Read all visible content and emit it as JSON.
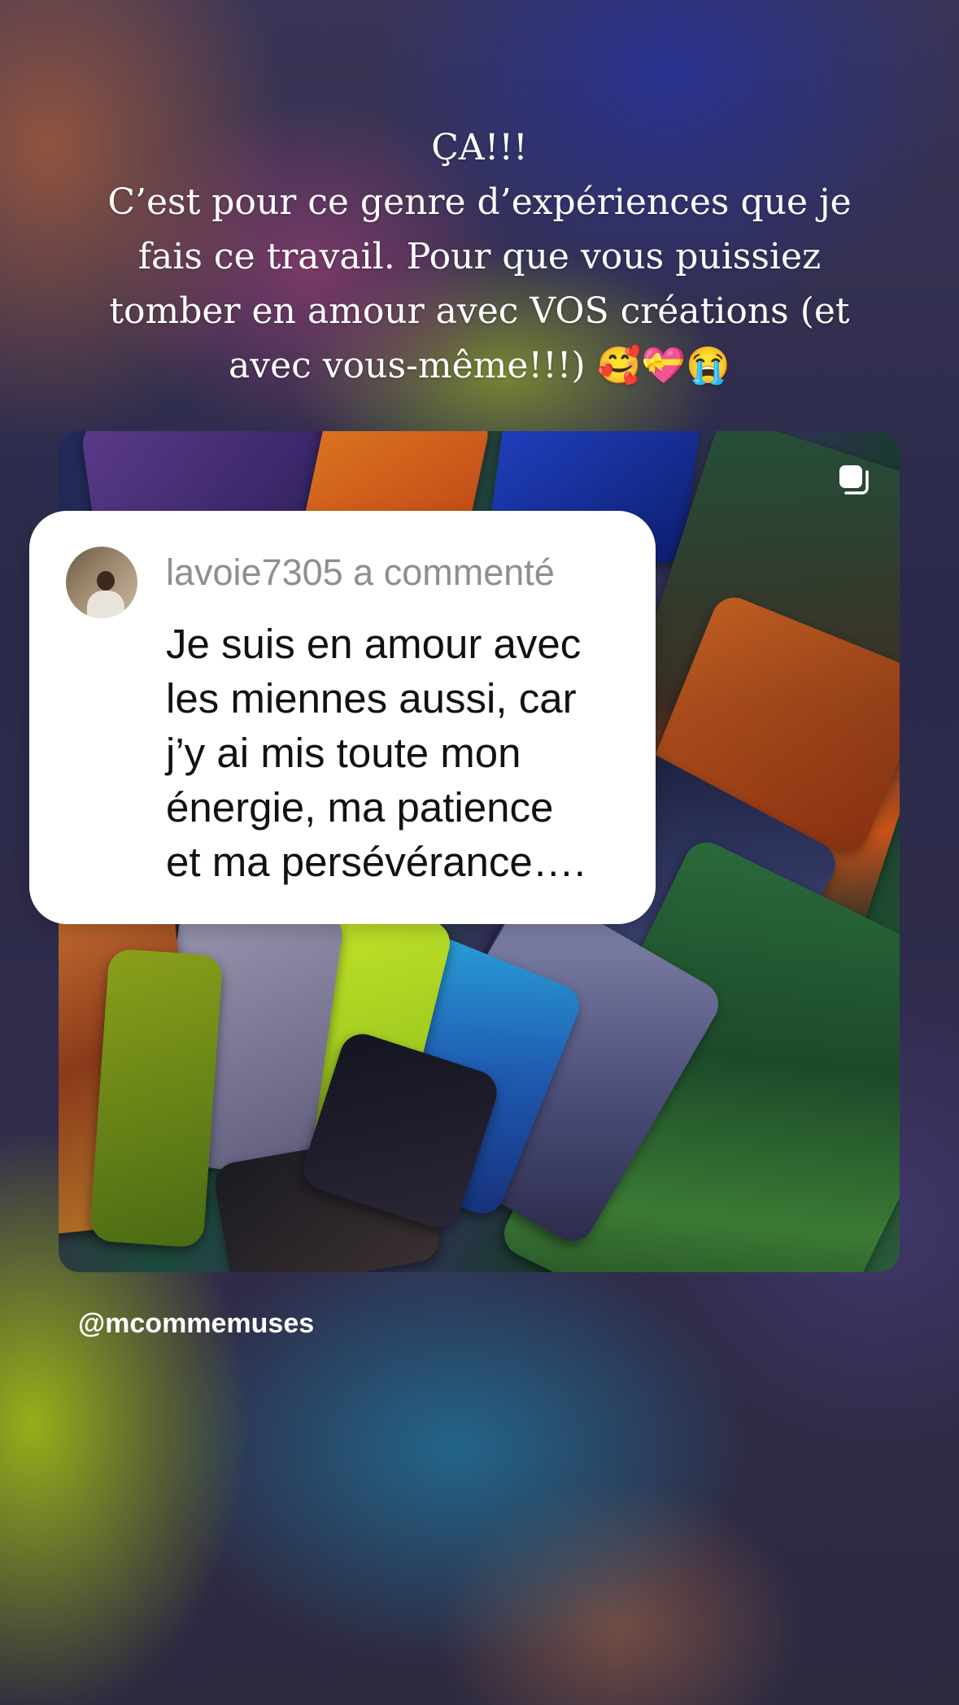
{
  "story": {
    "caption_lines": [
      "ÇA!!!",
      "C’est pour ce genre d’expériences que je",
      "fais ce travail. Pour que vous puissiez",
      "tomber en amour avec VOS créations (et",
      "avec vous-même!!!) 🥰💝😭"
    ],
    "comment": {
      "header": "lavoie7305 a commenté",
      "text_lines": [
        "Je suis en amour avec",
        "les miennes aussi, car",
        "j’y ai mis toute mon",
        "énergie, ma patience",
        "et ma persévérance…."
      ]
    },
    "author_handle": "@mcommemuses"
  },
  "icons": {
    "post": "multiple-images-icon",
    "avatar": "user-avatar"
  }
}
